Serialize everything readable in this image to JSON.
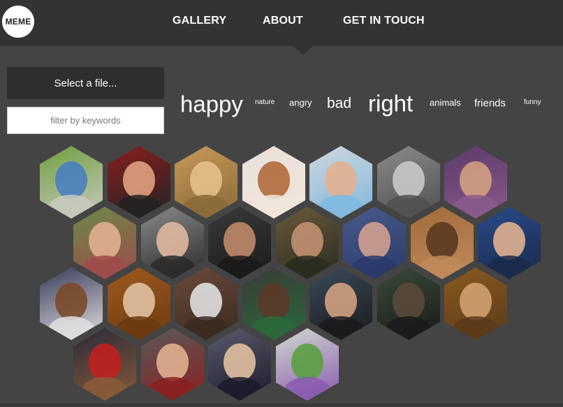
{
  "header": {
    "logo": "MEME",
    "nav": [
      "GALLERY",
      "ABOUT",
      "GET IN TOUCH"
    ]
  },
  "sidebar": {
    "file_button": "Select a file...",
    "filter_placeholder": "filter by keywords"
  },
  "tags": [
    "happy",
    "nature",
    "angry",
    "bad",
    "right",
    "animals",
    "friends",
    "funny"
  ],
  "gallery": [
    {
      "name": "meme-sound-of-music",
      "colors": [
        "#6f9f3e",
        "#4a7fbf",
        "#c9c9c0"
      ]
    },
    {
      "name": "meme-trump-shouting",
      "colors": [
        "#8a2020",
        "#e0a080",
        "#222222"
      ]
    },
    {
      "name": "meme-puppies-kissing",
      "colors": [
        "#c89858",
        "#e6c08a",
        "#8a6a3a"
      ]
    },
    {
      "name": "meme-baby-and-dog-sleeping",
      "colors": [
        "#e8e0da",
        "#b06a3a",
        "#f2e6dc"
      ]
    },
    {
      "name": "meme-baby-beach",
      "colors": [
        "#cfd6dc",
        "#e2b090",
        "#7fb8e0"
      ]
    },
    {
      "name": "meme-cat-smile",
      "colors": [
        "#8a8a8a",
        "#c8c8c8",
        "#505050"
      ]
    },
    {
      "name": "meme-willy-wonka",
      "colors": [
        "#5a3a6a",
        "#d0a080",
        "#8a5a8a"
      ]
    },
    {
      "name": "meme-laughing-toddler",
      "colors": [
        "#6a8a4a",
        "#e0b090",
        "#a04a4a"
      ]
    },
    {
      "name": "meme-old-man-pointing",
      "colors": [
        "#8a8a8a",
        "#e0b8a0",
        "#2a2a2a"
      ]
    },
    {
      "name": "meme-pauly-d",
      "colors": [
        "#3a3a3a",
        "#c08a6a",
        "#1a1a1a"
      ]
    },
    {
      "name": "meme-ancient-aliens",
      "colors": [
        "#6a5a3a",
        "#c09070",
        "#2a2a20"
      ]
    },
    {
      "name": "meme-dr-evil",
      "colors": [
        "#4a5a8a",
        "#d0a090",
        "#2a3a6a"
      ]
    },
    {
      "name": "meme-dancing-kids",
      "colors": [
        "#a06a3a",
        "#5a3a20",
        "#c08a5a"
      ]
    },
    {
      "name": "meme-trump-pointing",
      "colors": [
        "#2a4a8a",
        "#e0b090",
        "#1a2a4a"
      ]
    },
    {
      "name": "meme-surprised-baby",
      "colors": [
        "#3a3a5a",
        "#7a4a2a",
        "#e0e0e0"
      ]
    },
    {
      "name": "meme-dog-yoga",
      "colors": [
        "#a05a20",
        "#e0c0a0",
        "#6a3a10"
      ]
    },
    {
      "name": "meme-obama-laughing",
      "colors": [
        "#6a4a3a",
        "#e0e0e0",
        "#3a2a20"
      ]
    },
    {
      "name": "meme-kobe-and-player",
      "colors": [
        "#3a3a3a",
        "#5a3a2a",
        "#2a6a3a"
      ]
    },
    {
      "name": "meme-leonardo-toast",
      "colors": [
        "#3a4a5a",
        "#d0a080",
        "#1a1a1a"
      ]
    },
    {
      "name": "meme-morpheus",
      "colors": [
        "#3a4a3a",
        "#5a4a3a",
        "#1a1a1a"
      ]
    },
    {
      "name": "meme-boromir",
      "colors": [
        "#8a5a20",
        "#d0a070",
        "#5a3a1a"
      ]
    },
    {
      "name": "meme-oprah",
      "colors": [
        "#2a2a3a",
        "#c02020",
        "#8a5a3a"
      ]
    },
    {
      "name": "meme-picard-facepalm",
      "colors": [
        "#5a5a5a",
        "#e0b090",
        "#8a2020"
      ]
    },
    {
      "name": "meme-putin",
      "colors": [
        "#5a5a6a",
        "#e0c0a0",
        "#1a1a2a"
      ]
    },
    {
      "name": "meme-buzz-lightyear",
      "colors": [
        "#d0d8d0",
        "#5aa040",
        "#8a5ab0"
      ]
    }
  ]
}
